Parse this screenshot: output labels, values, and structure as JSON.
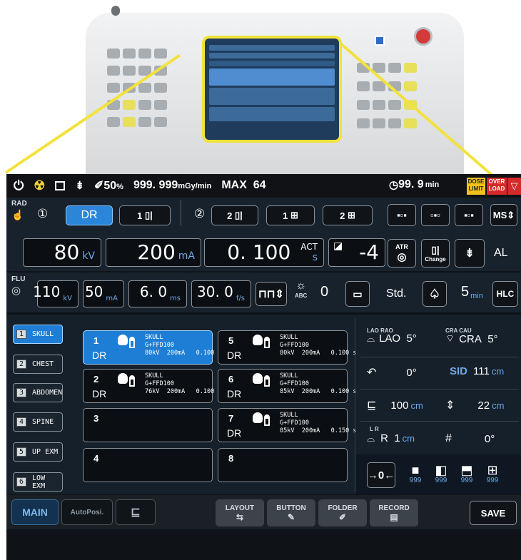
{
  "topbar": {
    "power": "⏻",
    "rad": "☢",
    "pct": "50",
    "pct_unit": "%",
    "dose": "999. 999",
    "dose_unit": "mGy/min",
    "max_label": "MAX",
    "max_value": "64",
    "timer": "99. 9",
    "timer_unit": "min",
    "dose_limit": "DOSE LIMIT",
    "over_load": "OVER LOAD"
  },
  "rad": {
    "label": "RAD",
    "focus1": "①",
    "dr": "DR",
    "b1": "1",
    "focus2": "②",
    "b2": "2",
    "grid1": "1",
    "grid2": "2",
    "ms": "MS",
    "kv": "80",
    "kv_unit": "kV",
    "ma": "200",
    "ma_unit": "mA",
    "sec": "0. 100",
    "act": "ACT",
    "sec_unit": "s",
    "density": "-4",
    "atr": "ATR",
    "change": "Change",
    "al": "AL"
  },
  "flu": {
    "label": "FLU",
    "kv": "110",
    "kv_unit": "kV",
    "ma": "50",
    "ma_unit": "mA",
    "ms": "6. 0",
    "ms_unit": "ms",
    "fs": "30. 0",
    "fs_unit": "f/s",
    "abc": "ABC",
    "abc_value": "0",
    "std": "Std.",
    "time": "5",
    "time_unit": "min",
    "hlc": "HLC"
  },
  "organs": [
    {
      "num": "1",
      "name": "SKULL"
    },
    {
      "num": "2",
      "name": "CHEST"
    },
    {
      "num": "3",
      "name": "ABDOMEN"
    },
    {
      "num": "4",
      "name": "SPINE"
    },
    {
      "num": "5",
      "name": "UP EXM"
    },
    {
      "num": "6",
      "name": "LOW EXM"
    }
  ],
  "slots": [
    {
      "n": "1",
      "mode": "DR",
      "t1": "SKULL",
      "t2": "G+FFD100",
      "t3": "80kV  200mA   0.100 s"
    },
    {
      "n": "2",
      "mode": "DR",
      "t1": "SKULL",
      "t2": "G+FFD100",
      "t3": "76kV  200mA   0.100 s"
    },
    {
      "n": "3",
      "mode": "",
      "t1": "",
      "t2": "",
      "t3": ""
    },
    {
      "n": "4",
      "mode": "",
      "t1": "",
      "t2": "",
      "t3": ""
    },
    {
      "n": "5",
      "mode": "DR",
      "t1": "SKULL",
      "t2": "G+FFD100",
      "t3": "80kV  200mA   0.100 s"
    },
    {
      "n": "6",
      "mode": "DR",
      "t1": "SKULL",
      "t2": "G+FFD100",
      "t3": "85kV  200mA   0.100 s"
    },
    {
      "n": "7",
      "mode": "DR",
      "t1": "SKULL",
      "t2": "G+FFD100",
      "t3": "85kV  200mA   0.150 s"
    },
    {
      "n": "8",
      "mode": "",
      "t1": "",
      "t2": "",
      "t3": ""
    }
  ],
  "position": {
    "lao_rao": "LAO RAO",
    "lao": "LAO",
    "lao_deg": "5°",
    "cra_cau": "CRA CAU",
    "cra": "CRA",
    "cra_deg": "5°",
    "rot_deg": "0°",
    "sid": "SID",
    "sid_val": "111",
    "sid_unit": "cm",
    "height_val": "100",
    "height_unit": "cm",
    "tilt_val": "22",
    "tilt_unit": "cm",
    "lr": "L R",
    "r": "R",
    "r_val": "1",
    "r_unit": "cm",
    "grid_deg": "0°",
    "counts": [
      "999",
      "999",
      "999",
      "999"
    ]
  },
  "bottom": {
    "main": "MAIN",
    "autopos": "AutoPosi.",
    "layout": "LAYOUT",
    "button": "BUTTON",
    "folder": "FOLDER",
    "record": "RECORD",
    "save": "SAVE"
  }
}
